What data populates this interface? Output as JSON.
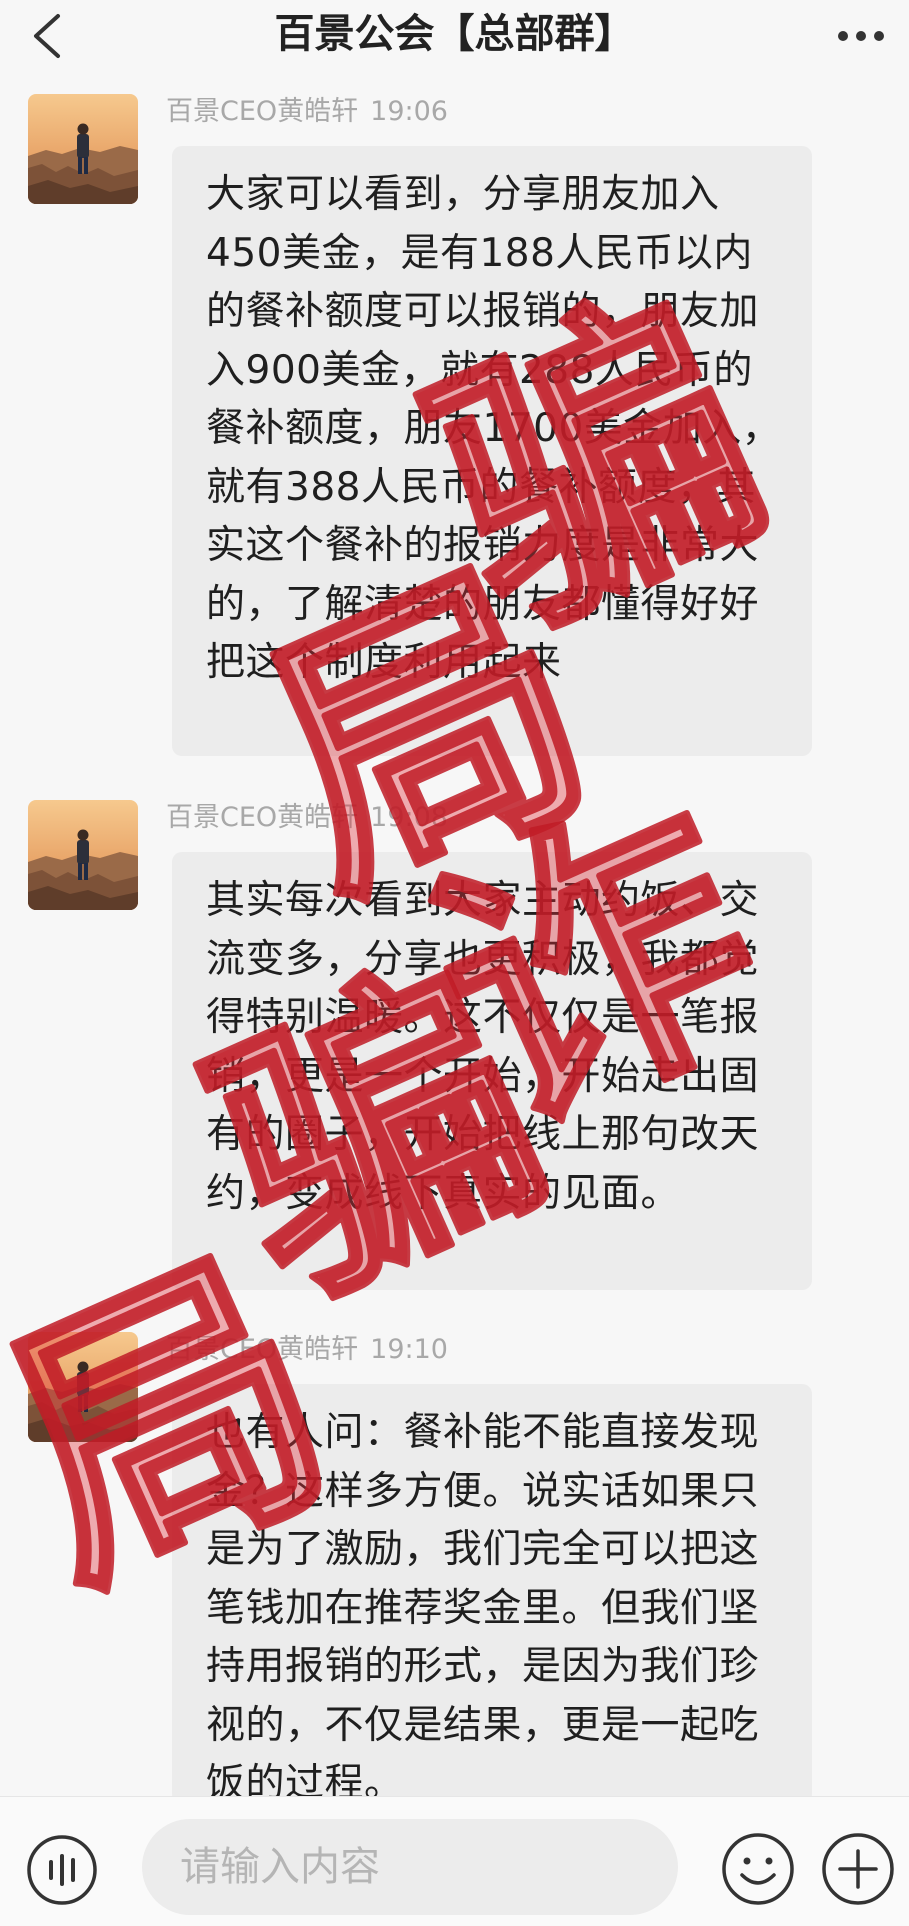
{
  "header": {
    "title": "百景公会【总部群】",
    "back_icon": "chevron-left-icon",
    "more_icon": "more-dots-icon"
  },
  "messages": [
    {
      "sender": "百景CEO黄皓轩",
      "time": "19:06",
      "text": "大家可以看到，分享朋友加入450美金，是有188人民币以内的餐补额度可以报销的，朋友加入900美金，就有288人民币的餐补额度，朋友1700美金加入，就有388人民币的餐补额度，其实这个餐补的报销力度是非常大的，了解清楚的朋友都懂得好好把这个制度利用起来"
    },
    {
      "sender": "百景CEO黄皓轩",
      "time": "19:08",
      "text": "其实每次看到大家主动约饭、交流变多，分享也更积极，我都觉得特别温暖。这不仅仅是一笔报销，更是一个开始，开始走出固有的圈子，开始把线上那句改天约，变成线下真实的见面。"
    },
    {
      "sender": "百景CEO黄皓轩",
      "time": "19:10",
      "text": "也有人问：餐补能不能直接发现金？这样多方便。说实话如果只是为了激励，我们完全可以把这笔钱加在推荐奖金里。但我们坚持用报销的形式，是因为我们珍视的，不仅是结果，更是一起吃饭的过程。"
    }
  ],
  "watermark": {
    "chars": [
      "骗",
      "局",
      "诈",
      "骗",
      "局"
    ],
    "color": "#e0303a"
  },
  "input": {
    "placeholder": "请输入内容"
  },
  "icons": {
    "voice": "voice-icon",
    "emoji": "emoji-icon",
    "add": "add-icon"
  }
}
